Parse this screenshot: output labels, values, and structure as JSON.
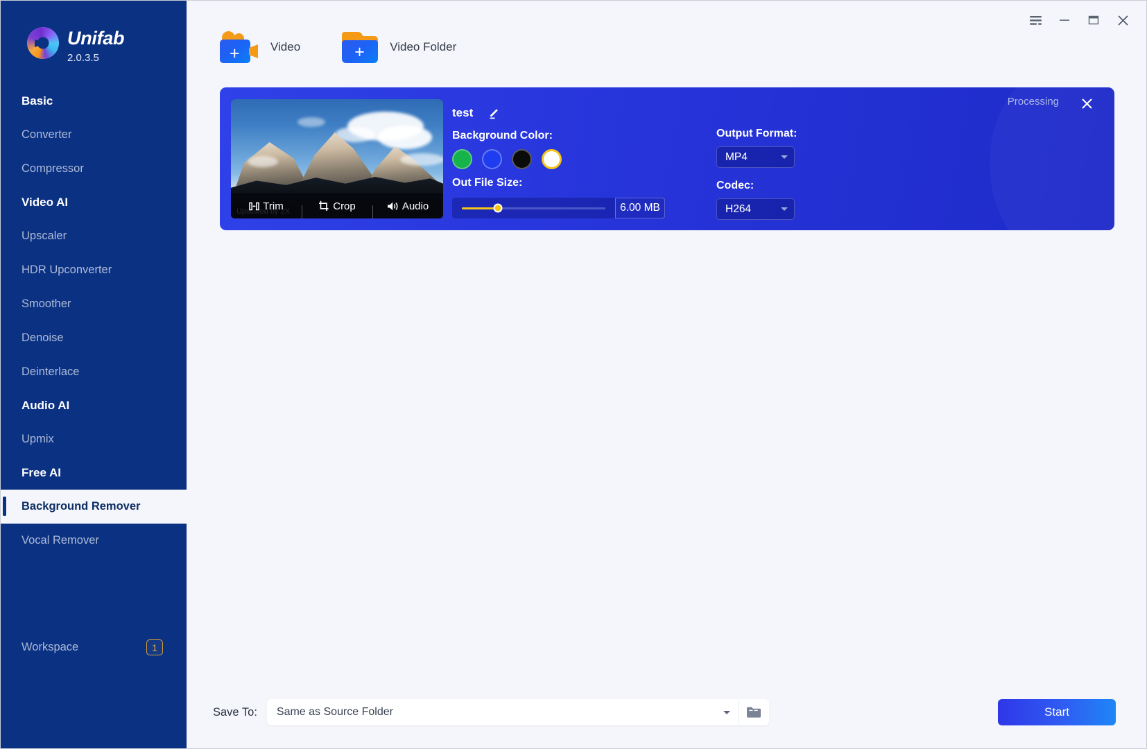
{
  "app": {
    "brand_name": "Unifab",
    "version": "2.0.3.5",
    "logo_icon": "unifab-swirl-logo"
  },
  "titlebar": {
    "menu_icon": "hamburger-menu-icon",
    "minimize_icon": "minimize-icon",
    "maximize_icon": "maximize-icon",
    "close_icon": "close-icon"
  },
  "sidebar": {
    "groups": [
      {
        "title": "Basic",
        "items": [
          "Converter",
          "Compressor"
        ]
      },
      {
        "title": "Video AI",
        "items": [
          "Upscaler",
          "HDR Upconverter",
          "Smoother",
          "Denoise",
          "Deinterlace"
        ]
      },
      {
        "title": "Audio AI",
        "items": [
          "Upmix"
        ]
      },
      {
        "title": "Free AI",
        "items": [
          "Background Remover",
          "Vocal Remover"
        ]
      }
    ],
    "active_item": "Background Remover",
    "workspace": {
      "label": "Workspace",
      "badge": "1"
    }
  },
  "source_bar": {
    "video": {
      "label": "Video",
      "icon": "add-video-icon"
    },
    "video_folder": {
      "label": "Video Folder",
      "icon": "add-video-folder-icon"
    }
  },
  "job_card": {
    "status": "Processing",
    "close_icon": "close-icon",
    "thumbnail": {
      "alt": "mountain-landscape-thumbnail",
      "upscale_badge": "Upscaled by 2X",
      "tools": [
        {
          "label": "Trim",
          "icon": "trim-icon"
        },
        {
          "label": "Crop",
          "icon": "crop-icon"
        },
        {
          "label": "Audio",
          "icon": "audio-icon"
        }
      ]
    },
    "file_title": "test",
    "edit_icon": "pencil-edit-icon",
    "background_color": {
      "label": "Background Color:",
      "swatches": [
        {
          "name": "green",
          "hex": "#16b34a",
          "selected": false
        },
        {
          "name": "blue",
          "hex": "#1f3df0",
          "selected": false
        },
        {
          "name": "black",
          "hex": "#0b0b0b",
          "selected": false
        },
        {
          "name": "white",
          "hex": "#ffffff",
          "selected": true
        }
      ],
      "selected_ring_hex": "#f5c518"
    },
    "out_file_size": {
      "label": "Out File Size:",
      "value": "6.00 MB",
      "slider_percent": 25,
      "accent_hex": "#f5c518"
    },
    "output_format": {
      "label": "Output Format:",
      "value": "MP4"
    },
    "codec": {
      "label": "Codec:",
      "value": "H264"
    }
  },
  "bottom_bar": {
    "save_to_label": "Save To:",
    "save_to_value": "Same as Source Folder",
    "browse_icon": "folder-icon",
    "start_label": "Start"
  }
}
